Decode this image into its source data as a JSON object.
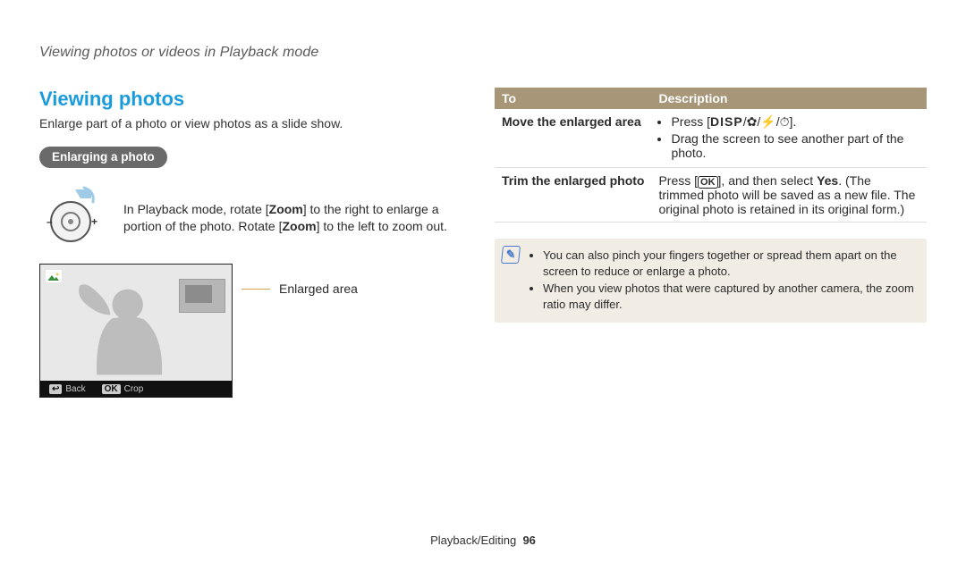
{
  "header": "Viewing photos or videos in Playback mode",
  "left": {
    "title": "Viewing photos",
    "lead": "Enlarge part of a photo or view photos as a slide show.",
    "pill": "Enlarging a photo",
    "zoom_text_pre": "In Playback mode, rotate [",
    "zoom_text_b1": "Zoom",
    "zoom_text_mid": "] to the right to enlarge a portion of the photo. Rotate [",
    "zoom_text_b2": "Zoom",
    "zoom_text_post": "] to the left to zoom out.",
    "callout": "Enlarged area",
    "bar_back": "Back",
    "bar_crop": "Crop",
    "bar_back_key": "↩",
    "bar_crop_key": "OK"
  },
  "table": {
    "h1": "To",
    "h2": "Description",
    "r1c1": "Move the enlarged area",
    "r1b1_pre": "Press [",
    "r1b1_disp": "DISP",
    "r1b1_post": "].",
    "r1b1_sep": "/",
    "r1b2": "Drag the screen to see another part of the photo.",
    "r2c1": "Trim the enlarged photo",
    "r2_pre": "Press [",
    "r2_ok": "OK",
    "r2_mid": "], and then select ",
    "r2_yes": "Yes",
    "r2_post": ". (The trimmed photo will be saved as a new file. The original photo is retained in its original form.)"
  },
  "note": {
    "b1": "You can also pinch your fingers together or spread them apart on the screen to reduce or enlarge a photo.",
    "b2": "When you view photos that were captured by another camera, the zoom ratio may differ."
  },
  "footer": {
    "section": "Playback/Editing",
    "page": "96"
  }
}
